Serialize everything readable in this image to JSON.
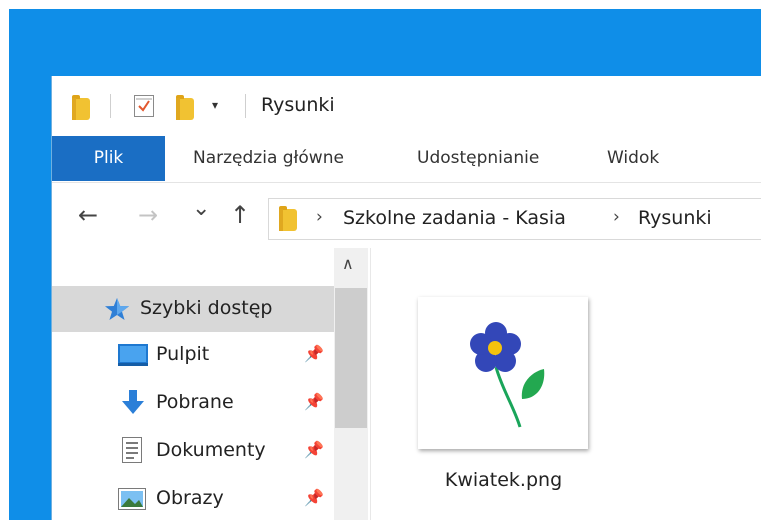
{
  "window": {
    "title": "Rysunki"
  },
  "quick_access_toolbar": {
    "icons": [
      "folder-icon",
      "properties-check-icon",
      "new-folder-icon",
      "customize-dropdown-icon"
    ]
  },
  "ribbon": {
    "tabs": [
      {
        "label": "Plik",
        "active": true
      },
      {
        "label": "Narzędzia główne",
        "active": false
      },
      {
        "label": "Udostępnianie",
        "active": false
      },
      {
        "label": "Widok",
        "active": false
      }
    ]
  },
  "navigation": {
    "back": "←",
    "forward": "→",
    "recent": "⌄",
    "up": "↑"
  },
  "address": {
    "segments": [
      "Szkolne zadania - Kasia",
      "Rysunki"
    ]
  },
  "nav_pane": {
    "items": [
      {
        "label": "Szybki dostęp",
        "icon": "star-icon",
        "selected": true,
        "pinned": false
      },
      {
        "label": "Pulpit",
        "icon": "desktop-icon",
        "selected": false,
        "pinned": true
      },
      {
        "label": "Pobrane",
        "icon": "download-icon",
        "selected": false,
        "pinned": true
      },
      {
        "label": "Dokumenty",
        "icon": "document-icon",
        "selected": false,
        "pinned": true
      },
      {
        "label": "Obrazy",
        "icon": "pictures-icon",
        "selected": false,
        "pinned": true
      }
    ]
  },
  "files": [
    {
      "name": "Kwiatek.png",
      "thumbnail": "flower-image"
    }
  ],
  "colors": {
    "desktop": "#0f8ee8",
    "ribbon_active": "#1a6ec4",
    "selection": "#d8d8d8",
    "folder": "#f1c232"
  }
}
